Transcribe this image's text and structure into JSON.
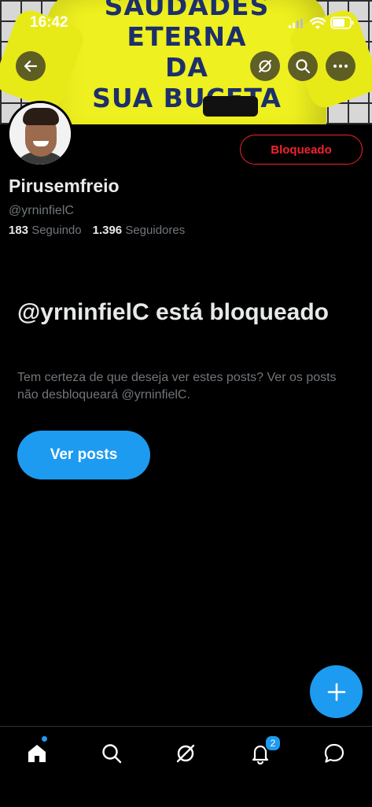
{
  "status_bar": {
    "time": "16:42"
  },
  "banner": {
    "shirt_text": [
      "SAUDADES",
      "ETERNA",
      "DA",
      "SUA BUCETA"
    ]
  },
  "profile": {
    "action_button": "Bloqueado",
    "display_name": "Pirusemfreio",
    "handle": "@yrninfielC",
    "following_count": "183",
    "following_label": "Seguindo",
    "followers_count": "1.396",
    "followers_label": "Seguidores"
  },
  "blocked_notice": {
    "title": "@yrninfielC está bloqueado",
    "description": "Tem certeza de que deseja ver estes posts? Ver os posts não desbloqueará @yrninfielC.",
    "button": "Ver posts"
  },
  "bottom_nav": {
    "items": [
      {
        "icon": "home-icon"
      },
      {
        "icon": "search-icon"
      },
      {
        "icon": "grok-icon"
      },
      {
        "icon": "notifications-icon"
      },
      {
        "icon": "messages-icon"
      }
    ],
    "notifications_badge": "2"
  },
  "colors": {
    "accent": "#1d9bf0",
    "blocked": "#f4212e",
    "background": "#000000",
    "secondary_text": "#71767b"
  }
}
